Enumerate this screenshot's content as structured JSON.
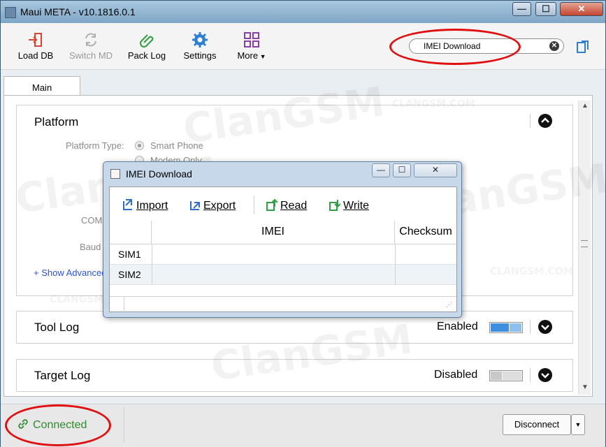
{
  "window": {
    "title": "Maui META - v10.1816.0.1",
    "min_glyph": "—",
    "max_glyph": "☐",
    "close_glyph": "✕"
  },
  "toolbar": {
    "load_db": "Load DB",
    "switch_md": "Switch MD",
    "pack_log": "Pack Log",
    "settings": "Settings",
    "more": "More"
  },
  "search": {
    "value": "IMEI Download",
    "clear_glyph": "✕"
  },
  "tabs": [
    {
      "label": "Main"
    }
  ],
  "platform": {
    "title": "Platform",
    "type_label": "Platform Type:",
    "options": [
      "Smart Phone",
      "Modem Only"
    ],
    "com_label": "COM",
    "baud_label": "Baud R",
    "advanced_link": "+ Show Advanced"
  },
  "tool_log": {
    "title": "Tool Log",
    "state": "Enabled",
    "on": true
  },
  "target_log": {
    "title": "Target Log",
    "state": "Disabled",
    "on": false
  },
  "status": {
    "connected": "Connected",
    "disconnect": "Disconnect"
  },
  "dialog": {
    "title": "IMEI Download",
    "buttons": {
      "import": "Import",
      "export": "Export",
      "read": "Read",
      "write": "Write"
    },
    "columns": [
      "IMEI",
      "Checksum"
    ],
    "rows": [
      {
        "label": "SIM1",
        "imei": "",
        "checksum": ""
      },
      {
        "label": "SIM2",
        "imei": "",
        "checksum": ""
      }
    ]
  },
  "watermark": {
    "big": "ClanGSM",
    "small": "CLANGSM.COM"
  },
  "colors": {
    "connected_green": "#2f8a2f",
    "annotation_red": "#e01010",
    "toggle_blue": "#3f8fe0"
  }
}
